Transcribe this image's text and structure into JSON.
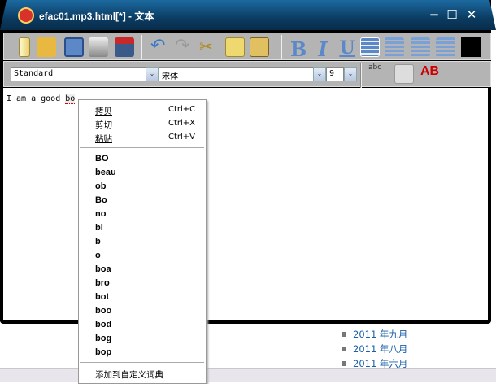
{
  "window": {
    "title": "efac01.mp3.html[*] - 文本",
    "minimize": "−",
    "maximize": "☐",
    "close": "✕"
  },
  "toolbar": {
    "icons": [
      "new-file",
      "open-folder",
      "save",
      "print",
      "save-pdf",
      "undo",
      "redo",
      "cut",
      "copy",
      "paste",
      "bold",
      "italic",
      "underline",
      "align-left",
      "align-center",
      "align-right",
      "justify",
      "color"
    ],
    "bold": "B",
    "italic": "I",
    "underline": "U",
    "spell_label": "abc",
    "ab_label": "AB"
  },
  "format": {
    "style": "Standard",
    "font": "宋体",
    "size": "9",
    "dropdown": "⌄"
  },
  "editor": {
    "text_before": "I am a good ",
    "misspelled": "bo"
  },
  "context_menu": {
    "edit_items": [
      {
        "label": "拷贝",
        "shortcut": "Ctrl+C"
      },
      {
        "label": "剪切",
        "shortcut": "Ctrl+X"
      },
      {
        "label": "粘贴",
        "shortcut": "Ctrl+V"
      }
    ],
    "suggestions": [
      "BO",
      "beau",
      "ob",
      "Bo",
      "no",
      "bi",
      "b",
      "o",
      "boa",
      "bro",
      "bot",
      "boo",
      "bod",
      "bog",
      "bop"
    ],
    "add_to_dictionary": "添加到自定义词典"
  },
  "background": {
    "archive": [
      "2011 年九月",
      "2011 年八月",
      "2011 年六月"
    ]
  },
  "colors": {
    "title_bar": "#0b3c62",
    "toolbar": "#b4b4b4",
    "link": "#1a5fa8"
  }
}
